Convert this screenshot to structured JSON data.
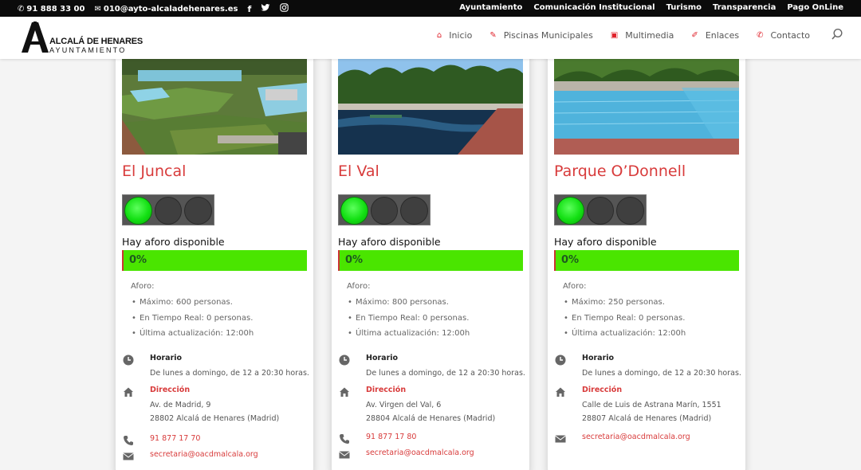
{
  "topbar": {
    "phone": "91 888 33 00",
    "email": "010@ayto-alcaladehenares.es",
    "social": [
      "facebook-icon",
      "twitter-icon",
      "instagram-icon"
    ],
    "links": [
      "Ayuntamiento",
      "Comunicación Institucional",
      "Turismo",
      "Transparencia",
      "Pago OnLine"
    ]
  },
  "header": {
    "logo_line1": "ALCALÁ DE HENARES",
    "logo_line2": "AYUNTAMIENTO",
    "nav": [
      {
        "label": "Inicio",
        "icon": "home-icon"
      },
      {
        "label": "Piscinas Municipales",
        "icon": "pin-icon"
      },
      {
        "label": "Multimedia",
        "icon": "instagram-icon"
      },
      {
        "label": "Enlaces",
        "icon": "pencil-icon"
      },
      {
        "label": "Contacto",
        "icon": "phone-icon"
      }
    ]
  },
  "common": {
    "status": "Hay aforo disponible",
    "aforo_label": "Aforo:",
    "horario_label": "Horario",
    "horario": "De lunes a domingo, de 12 a 20:30 horas.",
    "direccion_label": "Dirección",
    "actualizacion": "Última actualización:  12:00h"
  },
  "pools": [
    {
      "name": "El Juncal",
      "occupancy_pct": 0,
      "pct_label": "0%",
      "lights_on": 1,
      "maximo": "Máximo: 600 personas.",
      "tiempo_real": "En Tiempo Real: 0 personas.",
      "address1": "Av. de Madrid, 9",
      "address2": "28802 Alcalá de Henares (Madrid)",
      "phone": "91 877 17 70",
      "email": "secretaria@oacdmalcala.org"
    },
    {
      "name": "El Val",
      "occupancy_pct": 0,
      "pct_label": "0%",
      "lights_on": 1,
      "maximo": "Máximo: 800 personas.",
      "tiempo_real": "En Tiempo Real: 0 personas.",
      "address1": "Av. Virgen del Val, 6",
      "address2": "28804 Alcalá de Henares (Madrid)",
      "phone": "91 877 17 80",
      "email": "secretaria@oacdmalcala.org"
    },
    {
      "name": "Parque O’Donnell",
      "occupancy_pct": 0,
      "pct_label": "0%",
      "lights_on": 1,
      "maximo": "Máximo: 250 personas.",
      "tiempo_real": "En Tiempo Real: 0 personas.",
      "address1": "Calle de Luis de Astrana Marín, 1551",
      "address2": "28807 Alcalá de Henares (Madrid)",
      "phone": "",
      "email": "secretaria@oacdmalcala.org"
    }
  ],
  "colors": {
    "accent": "#d83b3b",
    "green": "#4ae500",
    "topbar": "#0b0b0b"
  }
}
